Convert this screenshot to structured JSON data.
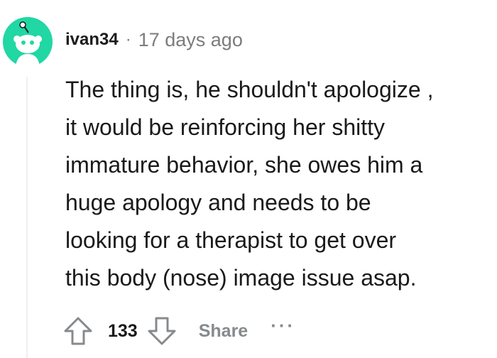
{
  "comment": {
    "author": "ivan34",
    "separator": "·",
    "timestamp": "17 days ago",
    "body_lines": [
      "The thing is, he shouldn't apologize ,",
      "it would be reinforcing her shitty",
      "immature behavior, she owes him a",
      "huge apology and needs to be",
      "looking for a therapist to get over",
      "this body (nose) image issue asap."
    ],
    "score": "133",
    "share_label": "Share",
    "more_label": "···"
  },
  "icons": {
    "avatar": "reddit-snoo-avatar-icon",
    "upvote": "upvote-arrow-icon",
    "downvote": "downvote-arrow-icon",
    "more": "more-options-icon"
  },
  "colors": {
    "avatar_bg": "#21d7a4",
    "text": "#1a1a1b",
    "muted": "#7c7c7c",
    "action_muted": "#878a8c"
  }
}
